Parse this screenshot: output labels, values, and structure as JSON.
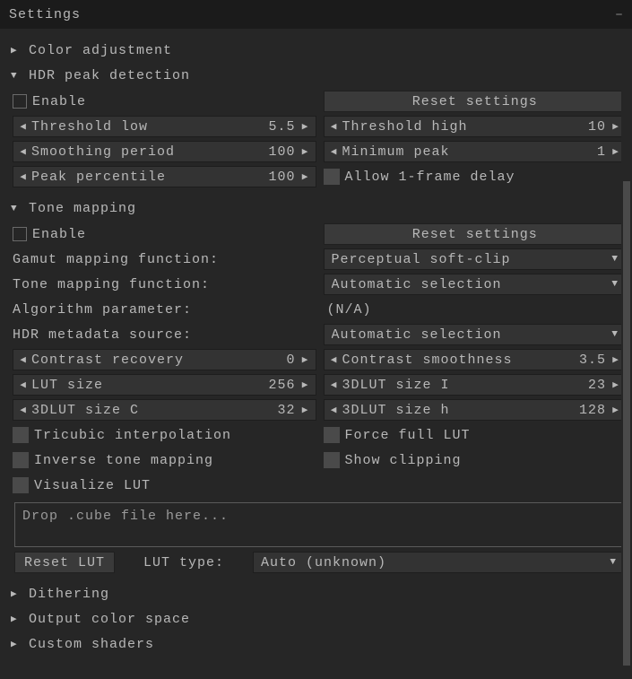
{
  "window": {
    "title": "Settings",
    "minimize_glyph": "–"
  },
  "sections": {
    "color_adjustment": {
      "label": "Color adjustment",
      "expanded": false
    },
    "hdr_peak": {
      "label": "HDR peak detection",
      "expanded": true,
      "enable_label": "Enable",
      "reset_label": "Reset settings",
      "threshold_low": {
        "label": "Threshold low",
        "value": "5.5"
      },
      "threshold_high": {
        "label": "Threshold high",
        "value": "10"
      },
      "smoothing_period": {
        "label": "Smoothing period",
        "value": "100"
      },
      "minimum_peak": {
        "label": "Minimum peak",
        "value": "1"
      },
      "peak_percentile": {
        "label": "Peak percentile",
        "value": "100"
      },
      "allow_delay_label": "Allow 1-frame delay"
    },
    "tone_mapping": {
      "label": "Tone mapping",
      "expanded": true,
      "enable_label": "Enable",
      "reset_label": "Reset settings",
      "gamut_label": "Gamut mapping function:",
      "gamut_value": "Perceptual soft-clip",
      "tonefn_label": "Tone mapping function:",
      "tonefn_value": "Automatic selection",
      "algparam_label": "Algorithm parameter:",
      "algparam_value": "(N/A)",
      "hdrmeta_label": "HDR metadata source:",
      "hdrmeta_value": "Automatic selection",
      "contrast_recovery": {
        "label": "Contrast recovery",
        "value": "0"
      },
      "contrast_smoothness": {
        "label": "Contrast smoothness",
        "value": "3.5"
      },
      "lut_size": {
        "label": "LUT size",
        "value": "256"
      },
      "lut3d_i": {
        "label": "3DLUT size I",
        "value": "23"
      },
      "lut3d_c": {
        "label": "3DLUT size C",
        "value": "32"
      },
      "lut3d_h": {
        "label": "3DLUT size h",
        "value": "128"
      },
      "tricubic_label": "Tricubic interpolation",
      "force_full_lut_label": "Force full LUT",
      "inverse_tm_label": "Inverse tone mapping",
      "show_clipping_label": "Show clipping",
      "visualize_lut_label": "Visualize LUT",
      "dropzone_placeholder": "Drop .cube file here...",
      "reset_lut_label": "Reset LUT",
      "lut_type_label": "LUT type:",
      "lut_type_value": "Auto (unknown)"
    },
    "dithering": {
      "label": "Dithering",
      "expanded": false
    },
    "output_cs": {
      "label": "Output color space",
      "expanded": false
    },
    "custom_shaders": {
      "label": "Custom shaders",
      "expanded": false
    }
  }
}
